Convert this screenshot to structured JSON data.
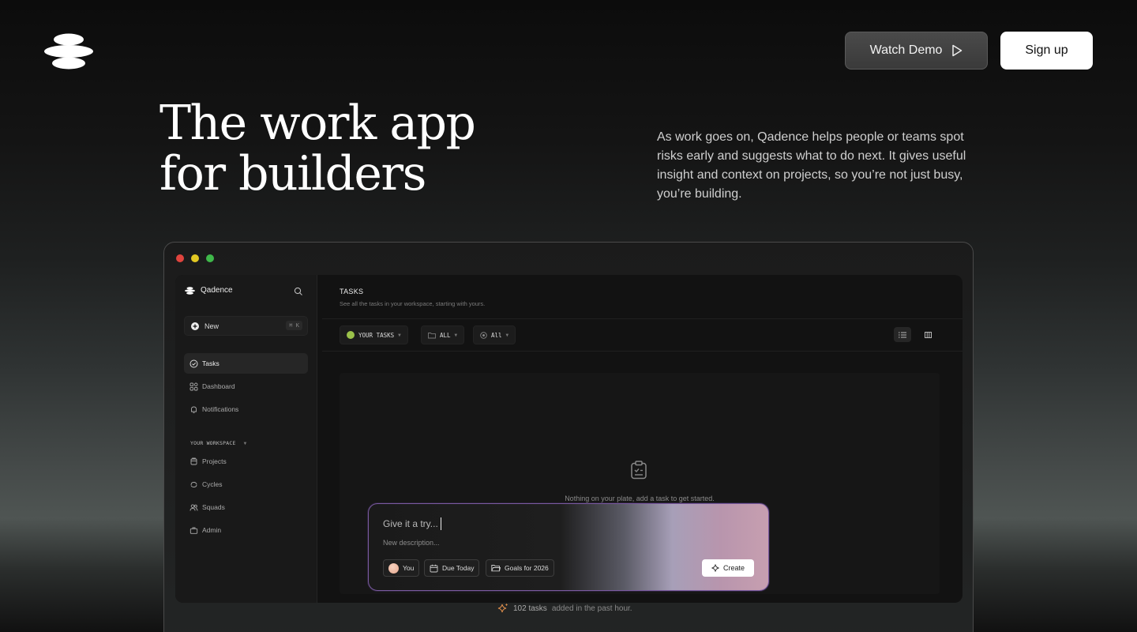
{
  "header": {
    "watch_demo_label": "Watch Demo",
    "signup_label": "Sign up"
  },
  "hero": {
    "title_line1": "The work app",
    "title_line2": "for builders",
    "description": "As work goes on, Qadence helps people or teams spot risks early and suggests what to do next. It gives useful insight and context on projects, so you’re not just busy, you’re building."
  },
  "app": {
    "brand_name": "Qadence",
    "new_label": "New",
    "new_shortcut": "⌘ K",
    "nav": [
      {
        "label": "Tasks",
        "icon": "check-circle-icon"
      },
      {
        "label": "Dashboard",
        "icon": "grid-icon"
      },
      {
        "label": "Notifications",
        "icon": "bell-icon"
      }
    ],
    "workspace_label": "YOUR WORKSPACE",
    "workspace_nav": [
      {
        "label": "Projects",
        "icon": "stack-icon"
      },
      {
        "label": "Cycles",
        "icon": "cycle-icon"
      },
      {
        "label": "Squads",
        "icon": "people-icon"
      },
      {
        "label": "Admin",
        "icon": "briefcase-icon"
      }
    ],
    "page_title": "TASKS",
    "page_subtitle": "See all the tasks in your workspace, starting with yours.",
    "filters": {
      "your_tasks": "YOUR TASKS",
      "all_folders": "ALL",
      "all_status": "All"
    },
    "empty_message": "Nothing on your plate, add a task to get started."
  },
  "composer": {
    "title_placeholder": "Give it a try...",
    "description_placeholder": "New description...",
    "assignee": "You",
    "due": "Due Today",
    "project": "Goals for 2026",
    "create_label": "Create"
  },
  "stat": {
    "count": "102 tasks",
    "suffix": "added in the past hour."
  },
  "colors": {
    "traffic_red": "#e0443e",
    "traffic_yellow": "#e2c822",
    "traffic_green": "#3fb84a",
    "accent_border": "#7a5aa0",
    "your_tasks_dot": "#9bc24a"
  }
}
